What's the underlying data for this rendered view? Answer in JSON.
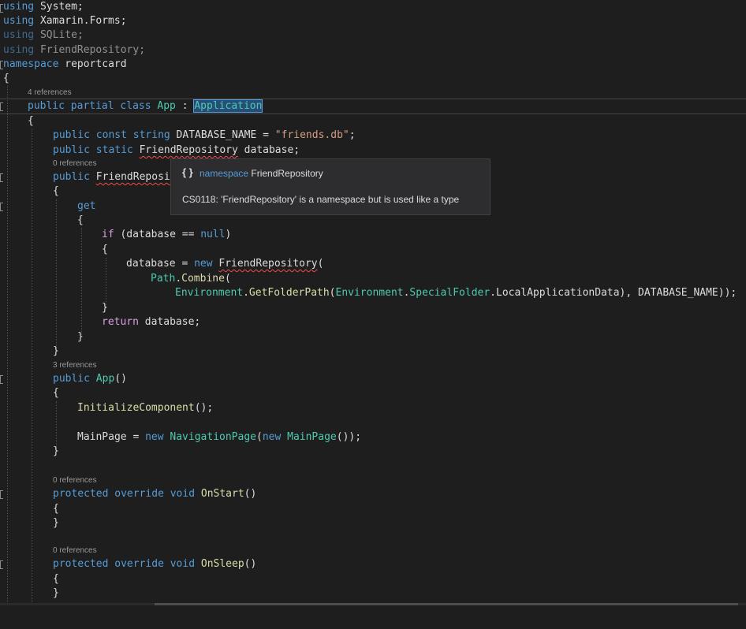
{
  "editor": {
    "lines": {
      "l01": {
        "a": "using",
        "b": " System;"
      },
      "l02": {
        "a": "using",
        "b": " Xamarin.Forms;"
      },
      "l03": {
        "a": "using",
        "b": " ",
        "c": "SQLite",
        "d": ";"
      },
      "l04": {
        "a": "using",
        "b": " ",
        "c": "FriendRepository",
        "d": ";"
      },
      "l05": {
        "a": "namespace",
        "b": " reportcard"
      },
      "l06": {
        "a": "{"
      },
      "l07": {
        "a": "public",
        "b": " ",
        "c": "partial",
        "d": " ",
        "e": "class",
        "f": " ",
        "g": "App",
        "h": " : ",
        "i": "Application"
      },
      "l08": {
        "a": "{"
      },
      "l09": {
        "a": "public",
        "b": " ",
        "c": "const",
        "d": " ",
        "e": "string",
        "f": " DATABASE_NAME = ",
        "g": "\"friends.db\"",
        "h": ";"
      },
      "l10": {
        "a": "public",
        "b": " ",
        "c": "static",
        "d": " ",
        "e": "FriendRepository",
        "f": " database;"
      },
      "l11": {
        "a": "public",
        "b": " ",
        "c": "FriendReposi"
      },
      "l12": {
        "a": "{"
      },
      "l13": {
        "a": "get"
      },
      "l14": {
        "a": "{"
      },
      "l15": {
        "a": "if",
        "b": " (database == ",
        "c": "null",
        "d": ")"
      },
      "l16": {
        "a": "{"
      },
      "l17": {
        "a": "database = ",
        "b": "new",
        "c": " ",
        "d": "FriendRepository",
        "e": "("
      },
      "l18": {
        "a": "Path",
        "b": ".",
        "c": "Combine",
        "d": "("
      },
      "l19": {
        "a": "Environment",
        "b": ".",
        "c": "GetFolderPath",
        "d": "(",
        "e": "Environment",
        "f": ".",
        "g": "SpecialFolder",
        "h": ".LocalApplicationData), DATABASE_NAME));"
      },
      "l20": {
        "a": "}"
      },
      "l21": {
        "a": "return",
        "b": " database;"
      },
      "l22": {
        "a": "}"
      },
      "l23": {
        "a": "}"
      },
      "l24": {
        "a": "public",
        "b": " ",
        "c": "App",
        "d": "()"
      },
      "l25": {
        "a": "{"
      },
      "l26": {
        "a": "InitializeComponent",
        "b": "();"
      },
      "l27": {
        "a": "MainPage = ",
        "b": "new",
        "c": " ",
        "d": "NavigationPage",
        "e": "(",
        "f": "new",
        "g": " ",
        "h": "MainPage",
        "i": "());"
      },
      "l28": {
        "a": "}"
      },
      "l29": {
        "a": "protected",
        "b": " ",
        "c": "override",
        "d": " ",
        "e": "void",
        "f": " ",
        "g": "OnStart",
        "h": "()"
      },
      "l30": {
        "a": "{"
      },
      "l31": {
        "a": "}"
      },
      "l32": {
        "a": "protected",
        "b": " ",
        "c": "override",
        "d": " ",
        "e": "void",
        "f": " ",
        "g": "OnSleep",
        "h": "()"
      },
      "l33": {
        "a": "{"
      },
      "l34": {
        "a": "}"
      }
    },
    "codelens": {
      "class_refs": "4 references",
      "prop_refs": "0 references",
      "ctor_refs": "3 references",
      "onstart_refs": "0 references",
      "onsleep_refs": "0 references"
    }
  },
  "tooltip": {
    "icon": "{ }",
    "kind": "namespace",
    "name": " FriendRepository",
    "message": "CS0118: 'FriendRepository' is a namespace but is used like a type"
  },
  "colors": {
    "background": "#1e1e1e",
    "keyword": "#569cd6",
    "control": "#d8a0df",
    "type": "#4ec9b0",
    "method": "#dcdcaa",
    "string": "#d69d85",
    "error_squiggle": "#f14c4c"
  }
}
